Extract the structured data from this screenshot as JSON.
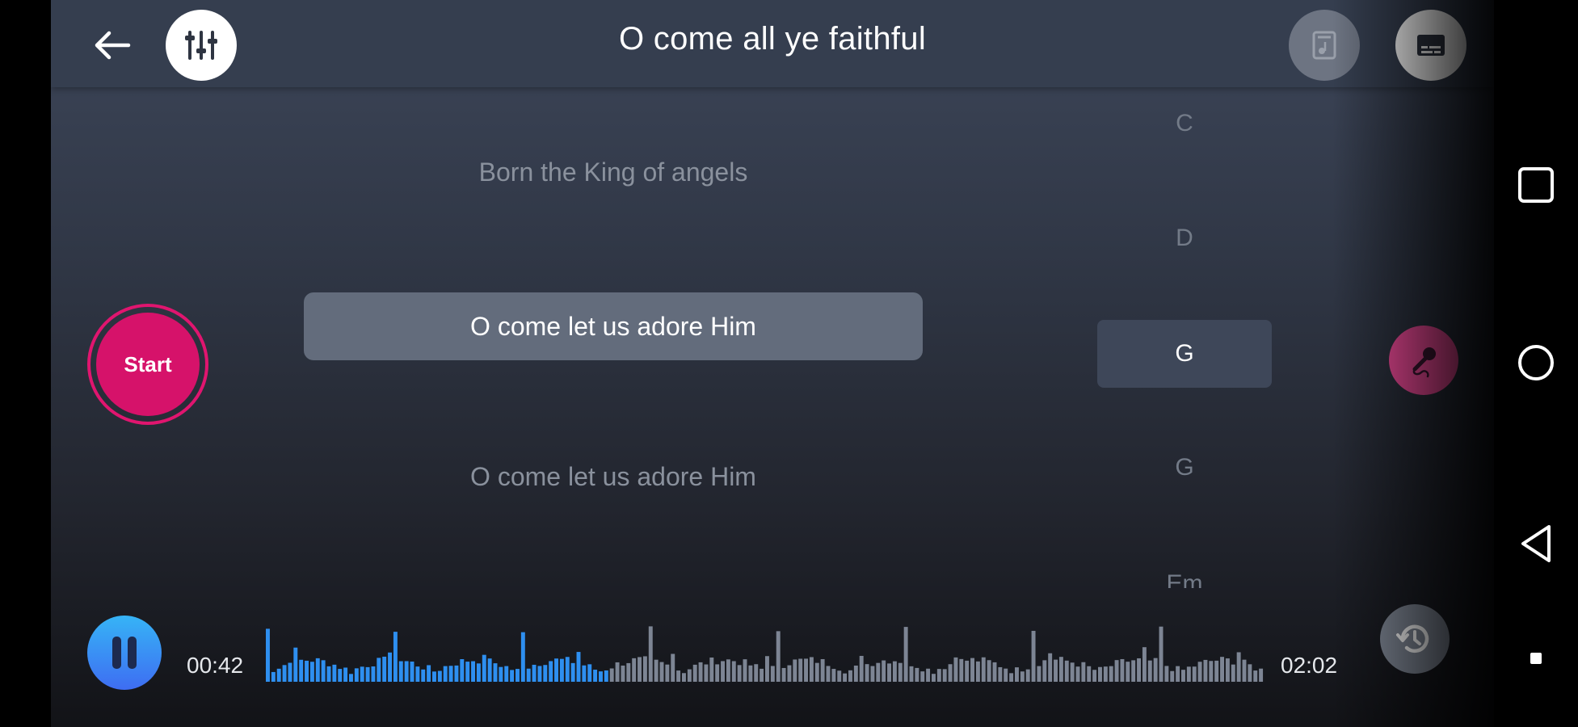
{
  "header": {
    "title": "O come all ye faithful",
    "icons": {
      "back": "arrow-left-icon",
      "mixer": "equalizer-icon",
      "songbook": "music-file-icon",
      "subtitles": "subtitles-icon"
    }
  },
  "lyrics": {
    "previous": "Born the King of angels",
    "current": "O come let us adore Him",
    "next": "O come let us adore Him"
  },
  "chords": {
    "items": [
      "C",
      "D",
      "G",
      "G",
      "Em"
    ],
    "current_index": 2
  },
  "controls": {
    "start_label": "Start",
    "elapsed": "00:42",
    "total": "02:02",
    "play_state": "playing",
    "progress_fraction": 0.344
  },
  "colors": {
    "accent_pink": "#d6126a",
    "mic_pink": "#ee4a98",
    "played_wave": "#2e8ff0",
    "unplayed_wave": "#7d8594",
    "play_gradient_top": "#36b4f6",
    "play_gradient_bottom": "#3e6df2"
  },
  "navigation": {
    "icons": [
      "recents-square-icon",
      "home-circle-icon",
      "back-triangle-icon"
    ]
  }
}
